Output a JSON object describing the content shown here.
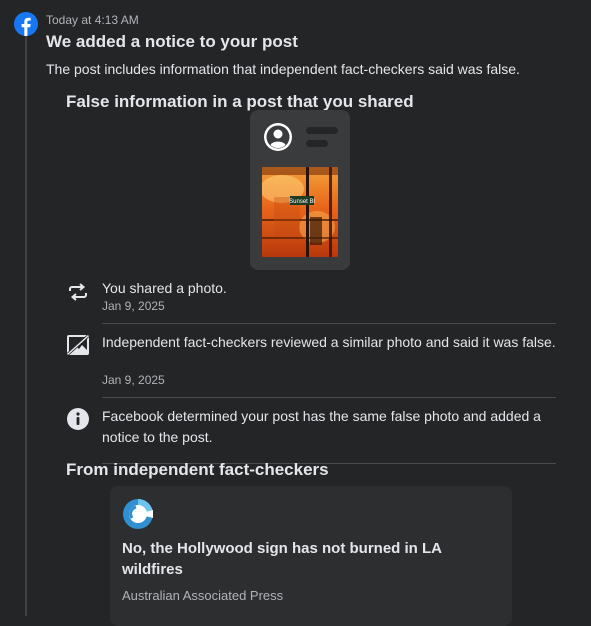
{
  "notification": {
    "timestamp": "Today at 4:13 AM",
    "title": "We added a notice to your post",
    "description": "The post includes information that independent fact-checkers said was false."
  },
  "false_info_section": {
    "heading": "False information in a post that you shared",
    "sign_text": "Sunset Bl"
  },
  "timeline": [
    {
      "icon": "share-icon",
      "text": "You shared a photo.",
      "date": "Jan 9, 2025"
    },
    {
      "icon": "false-photo-icon",
      "text": "Independent fact-checkers reviewed a similar photo and said it was false.",
      "date": "Jan 9, 2025"
    },
    {
      "icon": "info-icon",
      "text": "Facebook determined your post has the same false photo and added a notice to the post."
    }
  ],
  "fact_checkers": {
    "heading": "From independent fact-checkers",
    "article": {
      "headline": "No, the Hollywood sign has not burned in LA wildfires",
      "source": "Australian Associated Press"
    }
  },
  "colors": {
    "background": "#242526",
    "brand_blue": "#1877f2",
    "text_primary": "#e4e6eb",
    "text_secondary": "#b0b3b8"
  }
}
